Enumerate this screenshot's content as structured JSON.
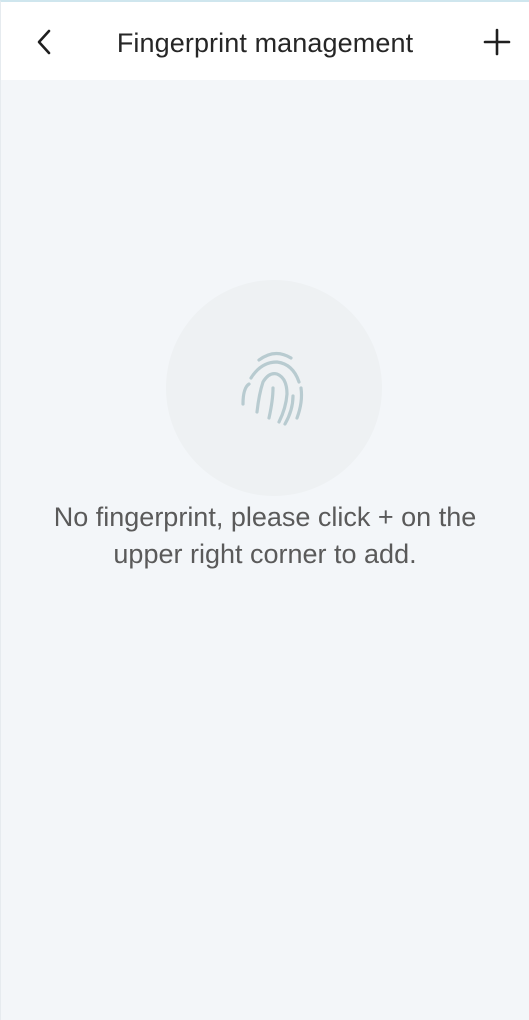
{
  "header": {
    "title": "Fingerprint management",
    "back_icon": "chevron-left-icon",
    "add_icon": "plus-icon"
  },
  "empty_state": {
    "icon": "fingerprint-icon",
    "message": "No fingerprint, please click + on the upper right corner to add."
  },
  "colors": {
    "background": "#f3f6f9",
    "header_background": "#ffffff",
    "title_text": "#262626",
    "message_text": "#5a5a5a",
    "icon_circle": "#eef1f3",
    "fingerprint_stroke": "#b8cbd0"
  }
}
